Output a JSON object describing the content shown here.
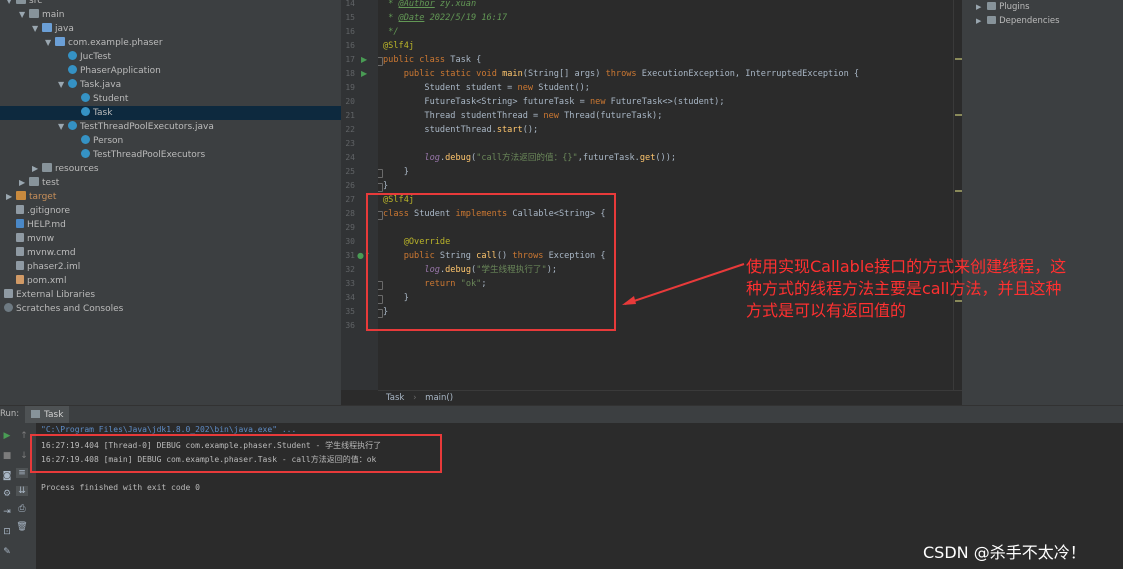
{
  "project_tree": {
    "items": [
      {
        "label": "src",
        "kind": "folder",
        "indent": 0,
        "arrow": "▼",
        "icon": "folder-icon"
      },
      {
        "label": "main",
        "kind": "folder",
        "indent": 1,
        "arrow": "▼",
        "icon": "folder-icon"
      },
      {
        "label": "java",
        "kind": "folder",
        "indent": 2,
        "arrow": "▼",
        "icon": "source-folder-icon"
      },
      {
        "label": "com.example.phaser",
        "kind": "package",
        "indent": 3,
        "arrow": "▼",
        "icon": "package-icon"
      },
      {
        "label": "JucTest",
        "kind": "class",
        "indent": 4,
        "arrow": "",
        "icon": "class-icon"
      },
      {
        "label": "PhaserApplication",
        "kind": "class",
        "indent": 4,
        "arrow": "",
        "icon": "class-icon"
      },
      {
        "label": "Task.java",
        "kind": "class",
        "indent": 4,
        "arrow": "▼",
        "icon": "java-file-icon"
      },
      {
        "label": "Student",
        "kind": "class",
        "indent": 5,
        "arrow": "",
        "icon": "class-icon"
      },
      {
        "label": "Task",
        "kind": "class",
        "indent": 5,
        "arrow": "",
        "icon": "class-icon",
        "selected": true
      },
      {
        "label": "TestThreadPoolExecutors.java",
        "kind": "class",
        "indent": 4,
        "arrow": "▼",
        "icon": "java-file-icon"
      },
      {
        "label": "Person",
        "kind": "class",
        "indent": 5,
        "arrow": "",
        "icon": "class-icon"
      },
      {
        "label": "TestThreadPoolExecutors",
        "kind": "class",
        "indent": 5,
        "arrow": "",
        "icon": "class-icon"
      },
      {
        "label": "resources",
        "kind": "folder",
        "indent": 2,
        "arrow": "▶",
        "icon": "resources-folder-icon"
      },
      {
        "label": "test",
        "kind": "folder",
        "indent": 1,
        "arrow": "▶",
        "icon": "folder-icon"
      },
      {
        "label": "target",
        "kind": "target",
        "indent": 0,
        "arrow": "▶",
        "icon": "target-folder-icon"
      },
      {
        "label": ".gitignore",
        "kind": "file",
        "indent": 0,
        "arrow": "",
        "icon": "gitignore-file-icon"
      },
      {
        "label": "HELP.md",
        "kind": "md",
        "indent": 0,
        "arrow": "",
        "icon": "markdown-file-icon"
      },
      {
        "label": "mvnw",
        "kind": "file",
        "indent": 0,
        "arrow": "",
        "icon": "file-icon"
      },
      {
        "label": "mvnw.cmd",
        "kind": "file",
        "indent": 0,
        "arrow": "",
        "icon": "file-icon"
      },
      {
        "label": "phaser2.iml",
        "kind": "file",
        "indent": 0,
        "arrow": "",
        "icon": "iml-file-icon"
      },
      {
        "label": "pom.xml",
        "kind": "xml",
        "indent": 0,
        "arrow": "",
        "icon": "maven-file-icon"
      },
      {
        "label": "External Libraries",
        "kind": "lib",
        "indent": -1,
        "arrow": "",
        "icon": "library-icon"
      },
      {
        "label": "Scratches and Consoles",
        "kind": "scr",
        "indent": -1,
        "arrow": "",
        "icon": "scratches-icon"
      }
    ]
  },
  "editor": {
    "lines": [
      {
        "n": "14",
        "text": " * @Author zy.xuan"
      },
      {
        "n": "15",
        "text": " * @Date 2022/5/19 16:17"
      },
      {
        "n": "16",
        "text": " */"
      },
      {
        "n": "16",
        "text": "@Slf4j"
      },
      {
        "n": "17",
        "text": "public class Task {",
        "run": true
      },
      {
        "n": "18",
        "text": "    public static void main(String[] args) throws ExecutionException, InterruptedException {",
        "run": true
      },
      {
        "n": "19",
        "text": "        Student student = new Student();"
      },
      {
        "n": "20",
        "text": "        FutureTask<String> futureTask = new FutureTask<>(student);"
      },
      {
        "n": "21",
        "text": "        Thread studentThread = new Thread(futureTask);"
      },
      {
        "n": "22",
        "text": "        studentThread.start();"
      },
      {
        "n": "23",
        "text": ""
      },
      {
        "n": "24",
        "text": "        log.debug(\"call方法返回的值：{}\",futureTask.get());"
      },
      {
        "n": "25",
        "text": "    }"
      },
      {
        "n": "26",
        "text": "}"
      },
      {
        "n": "27",
        "text": "@Slf4j"
      },
      {
        "n": "28",
        "text": "class Student implements Callable<String> {"
      },
      {
        "n": "29",
        "text": ""
      },
      {
        "n": "30",
        "text": "    @Override"
      },
      {
        "n": "31",
        "text": "    public String call() throws Exception {",
        "impl": true
      },
      {
        "n": "32",
        "text": "        log.debug(\"学生线程执行了\");"
      },
      {
        "n": "33",
        "text": "        return \"ok\";"
      },
      {
        "n": "34",
        "text": "    }"
      },
      {
        "n": "35",
        "text": "}"
      },
      {
        "n": "36",
        "text": ""
      }
    ],
    "breadcrumb": [
      "Task",
      "main()"
    ]
  },
  "right_panel": {
    "items": [
      "Plugins",
      "Dependencies"
    ]
  },
  "run_panel": {
    "title": "Run:",
    "tab": "Task",
    "lines": [
      {
        "text": "\"C:\\Program Files\\Java\\jdk1.8.0_202\\bin\\java.exe\" ...",
        "kind": "cmd"
      },
      {
        "text": "16:27:19.404 [Thread-0] DEBUG com.example.phaser.Student - 学生线程执行了",
        "kind": "log"
      },
      {
        "text": "16:27:19.408 [main] DEBUG com.example.phaser.Task - call方法返回的值：ok",
        "kind": "log"
      },
      {
        "text": "",
        "kind": "blank"
      },
      {
        "text": "Process finished with exit code 0",
        "kind": "log"
      }
    ]
  },
  "annotation": {
    "text": "使用实现Callable接口的方式来创建线程，这种方式的线程方法主要是call方法，并且这种方式是可以有返回值的",
    "color": "#ff3030"
  },
  "watermark": "CSDN @杀手不太冷！"
}
